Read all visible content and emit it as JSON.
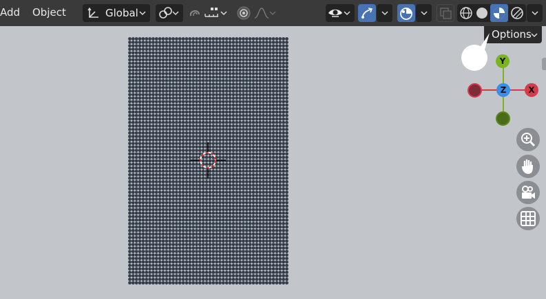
{
  "header": {
    "menu": {
      "add": "Add",
      "object": "Object"
    },
    "orientation": {
      "label": "Global",
      "icon": "transform-orientation-icon"
    },
    "pivot": {
      "icon": "pivot-point-icon"
    },
    "snap": {
      "icon": "snap-magnet-icon",
      "increment_icon": "snap-increment-icon"
    },
    "proportional": {
      "icon": "proportional-editing-icon",
      "falloff_icon": "falloff-curve-icon"
    },
    "visibility": {
      "icon": "eye-icon"
    },
    "gizmo_toggle": {
      "icon": "gizmo-arrow-icon",
      "active": true
    },
    "overlays_toggle": {
      "icon": "overlays-icon",
      "active": true
    },
    "xray": {
      "icon": "xray-icon"
    },
    "shading": {
      "wireframe_icon": "wireframe-shading-icon",
      "solid_icon": "solid-shading-icon",
      "material_icon": "material-preview-icon",
      "rendered_icon": "rendered-shading-icon",
      "active": "material"
    }
  },
  "options": {
    "label": "Options"
  },
  "gizmo": {
    "x": "X",
    "y": "Y",
    "z": "Z"
  },
  "navigation": [
    "zoom-icon",
    "hand-pan-icon",
    "camera-icon",
    "grid-ortho-icon"
  ],
  "colors": {
    "viewport_bg": "#c2c5c9",
    "header_bg": "#3a3a3a",
    "active_blue": "#4772b3",
    "x_axis": "#d73a4a",
    "y_axis": "#7ab51d",
    "z_axis": "#3a8ee6",
    "point_color": "#333c49"
  },
  "scene": {
    "point_grid_columns": 48,
    "point_grid_rows": 71
  }
}
